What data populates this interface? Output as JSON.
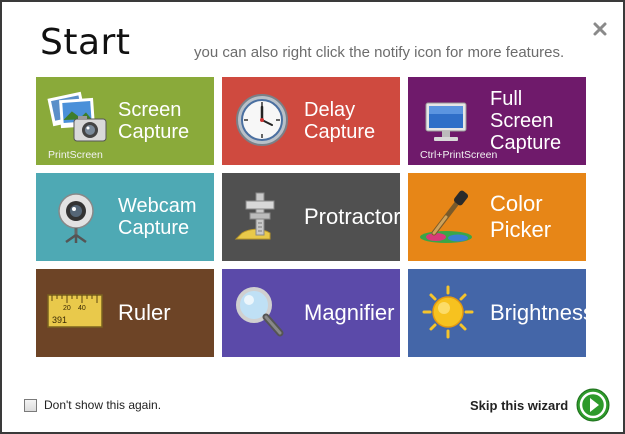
{
  "header": {
    "title": "Start",
    "hint": "you can also right click the notify icon for more features."
  },
  "tiles": [
    {
      "label": "Screen Capture",
      "shortcut": "PrintScreen",
      "color": "#8aaa3a",
      "icon": "camera-photos-icon"
    },
    {
      "label": "Delay Capture",
      "shortcut": "",
      "color": "#cf4a3f",
      "icon": "clock-icon"
    },
    {
      "label": "Full Screen Capture",
      "shortcut": "Ctrl+PrintScreen",
      "color": "#6f1a6b",
      "icon": "monitor-icon"
    },
    {
      "label": "Webcam Capture",
      "shortcut": "",
      "color": "#4ea9b4",
      "icon": "webcam-icon"
    },
    {
      "label": "Protractor",
      "shortcut": "",
      "color": "#505050",
      "icon": "caliper-protractor-icon"
    },
    {
      "label": "Color Picker",
      "shortcut": "",
      "color": "#e78617",
      "icon": "eyedropper-icon"
    },
    {
      "label": "Ruler",
      "shortcut": "",
      "color": "#6d4426",
      "icon": "ruler-icon",
      "ruler_ticks": [
        "20",
        "40"
      ],
      "ruler_value": "391"
    },
    {
      "label": "Magnifier",
      "shortcut": "",
      "color": "#5b4aa9",
      "icon": "magnifier-icon"
    },
    {
      "label": "Brightness",
      "shortcut": "",
      "color": "#4466a8",
      "icon": "sun-icon"
    }
  ],
  "footer": {
    "dont_show_label": "Don't show this again.",
    "dont_show_checked": false,
    "skip_label": "Skip this wizard"
  },
  "colors": {
    "skip_button": "#2e9a2b"
  }
}
